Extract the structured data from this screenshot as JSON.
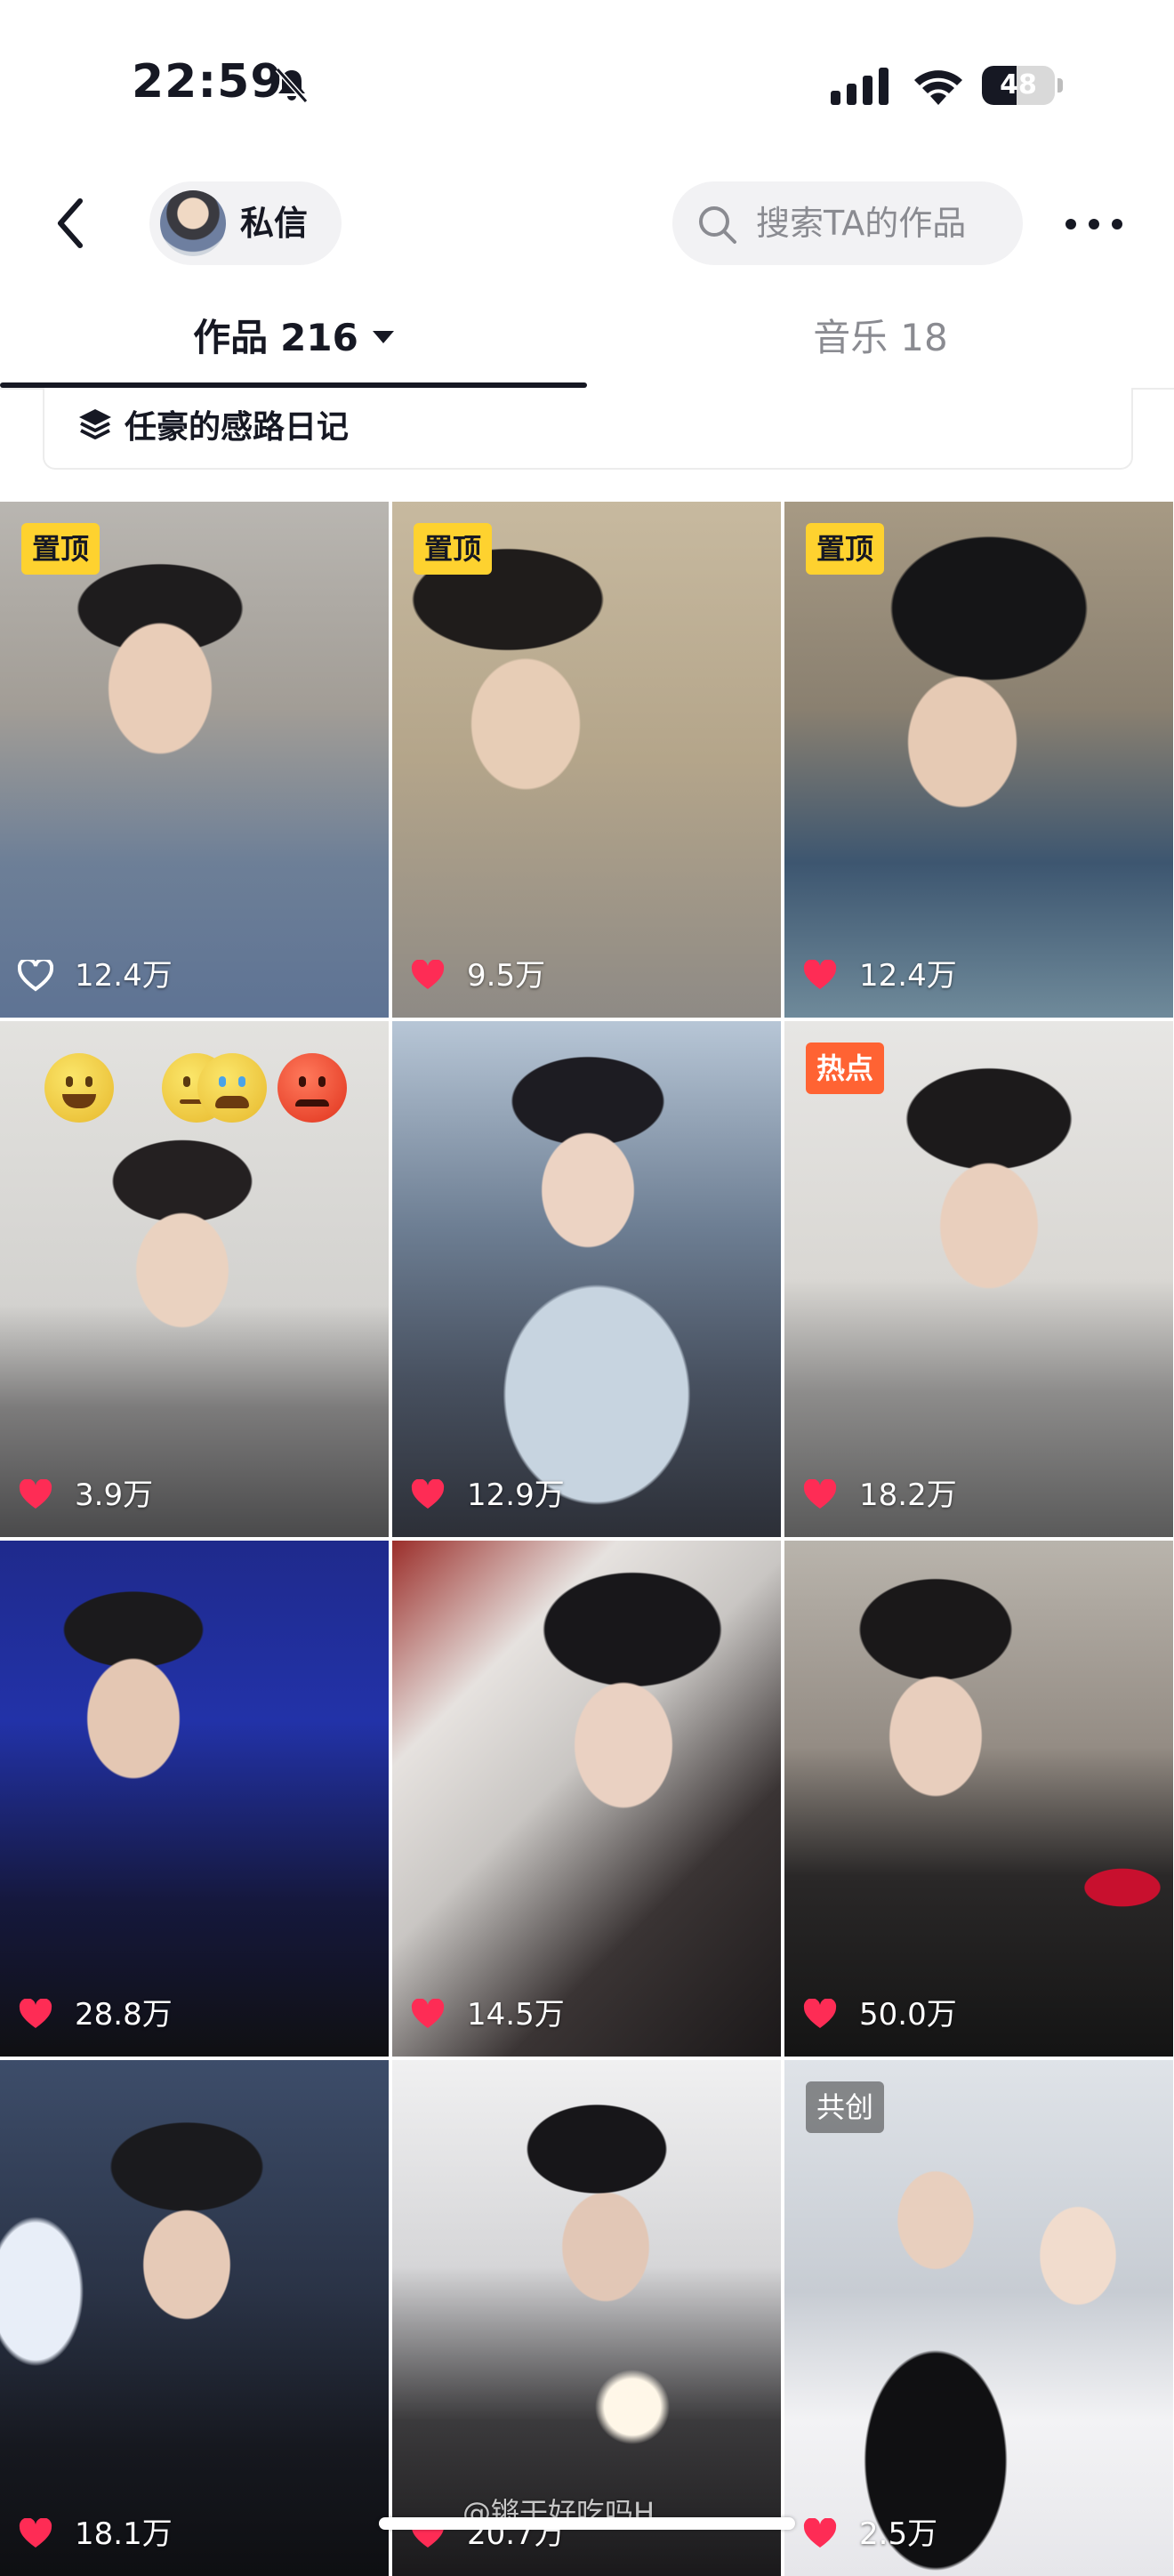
{
  "status_bar": {
    "time": "22:59",
    "battery": "48",
    "battery_level": 0.48,
    "icons": [
      "mute-bell-icon",
      "cellular-signal-icon",
      "wifi-icon",
      "battery-icon"
    ]
  },
  "header": {
    "back_icon": "chevron-left-icon",
    "dm_label": "私信",
    "search_placeholder": "搜索TA的作品",
    "more_icon": "more-dots-icon"
  },
  "tabs": [
    {
      "label": "作品",
      "count": "216",
      "active": true
    },
    {
      "label": "音乐",
      "count": "18",
      "active": false
    }
  ],
  "collection": {
    "icon": "layers-icon",
    "title": "任豪的感路日记"
  },
  "videos": [
    {
      "badge": "置顶",
      "badge_type": "pin",
      "likes": "12.4万",
      "liked": false
    },
    {
      "badge": "置顶",
      "badge_type": "pin",
      "likes": "9.5万",
      "liked": true
    },
    {
      "badge": "置顶",
      "badge_type": "pin",
      "likes": "12.4万",
      "liked": true
    },
    {
      "badge": "",
      "badge_type": "none",
      "likes": "3.9万",
      "liked": true
    },
    {
      "badge": "",
      "badge_type": "none",
      "likes": "12.9万",
      "liked": true
    },
    {
      "badge": "热点",
      "badge_type": "hot",
      "likes": "18.2万",
      "liked": true
    },
    {
      "badge": "",
      "badge_type": "none",
      "likes": "28.8万",
      "liked": true
    },
    {
      "badge": "",
      "badge_type": "none",
      "likes": "14.5万",
      "liked": true
    },
    {
      "badge": "",
      "badge_type": "none",
      "likes": "50.0万",
      "liked": true
    },
    {
      "badge": "",
      "badge_type": "none",
      "likes": "18.1万",
      "liked": true
    },
    {
      "badge": "",
      "badge_type": "none",
      "likes": "20.7万",
      "liked": true
    },
    {
      "badge": "共创",
      "badge_type": "co",
      "likes": "2.5万",
      "liked": true
    }
  ],
  "emoji_icons": [
    "grinning-face-icon",
    "neutral-face-icon",
    "crying-face-icon",
    "angry-face-icon"
  ],
  "watermark": "@锵干好吃吗H",
  "colors": {
    "accent_like": "#fe2c55",
    "badge_pin": "#fed22f",
    "badge_hot": "#ff6333",
    "text_primary": "#161823",
    "text_secondary": "#8a8b91"
  }
}
